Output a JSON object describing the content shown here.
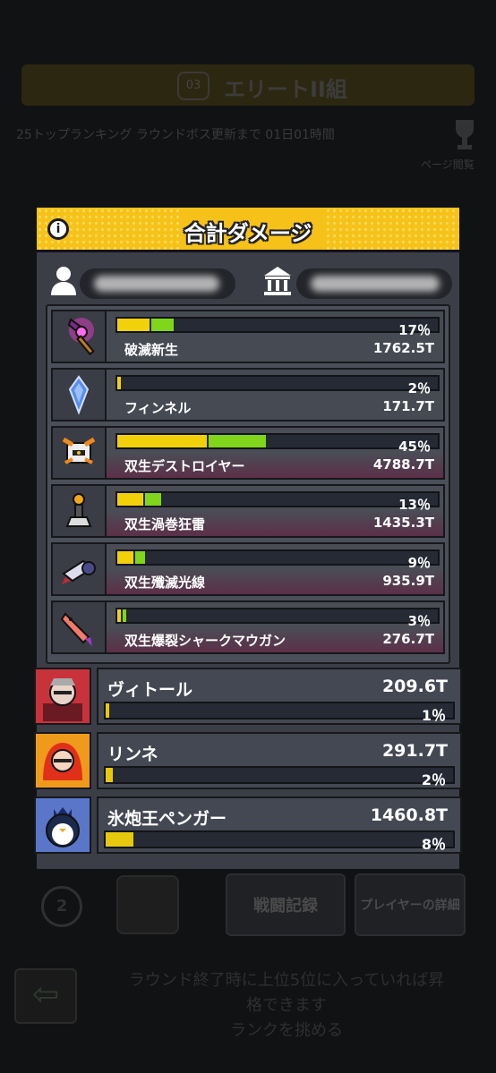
{
  "background": {
    "banner_icon": "03",
    "banner_title": "エリートII組",
    "info_text": "25トップランキング ラウンドボス更新まで 01日01時間",
    "manual_label": "ページ閲覧",
    "circle_number": "2",
    "battle_log_button": "戦闘記録",
    "player_detail_button": "プレイヤーの詳細",
    "bottom_message_1": "ラウンド終了時に上位5位に入っていれば昇",
    "bottom_message_2": "格できます",
    "bottom_message_3": "ランクを挑める"
  },
  "modal": {
    "title": "合計ダメージ",
    "info_icon": "i",
    "owner_icon": "person-icon",
    "guild_icon": "bank-icon"
  },
  "weapons": [
    {
      "name": "破滅新生",
      "percent": "17％",
      "damage": "1762.5T",
      "share": 0.17,
      "segments": [
        {
          "color": "#f2d10a",
          "w": 0.1
        },
        {
          "color": "#7fd61a",
          "w": 0.07
        }
      ],
      "highlight": false,
      "icon": "purple-staff-icon"
    },
    {
      "name": "フィンネル",
      "percent": "2％",
      "damage": "171.7T",
      "share": 0.02,
      "segments": [
        {
          "color": "#f2d10a",
          "w": 0.01
        }
      ],
      "highlight": false,
      "icon": "blue-crystal-icon"
    },
    {
      "name": "双生デストロイヤー",
      "percent": "45％",
      "damage": "4788.7T",
      "share": 0.45,
      "segments": [
        {
          "color": "#f2d10a",
          "w": 0.28
        },
        {
          "color": "#7fd61a",
          "w": 0.18
        }
      ],
      "highlight": true,
      "icon": "robot-destroyer-icon"
    },
    {
      "name": "双生渦巻狂雷",
      "percent": "13％",
      "damage": "1435.3T",
      "share": 0.13,
      "segments": [
        {
          "color": "#f2d10a",
          "w": 0.08
        },
        {
          "color": "#7fd61a",
          "w": 0.05
        }
      ],
      "highlight": true,
      "icon": "tesla-coil-icon"
    },
    {
      "name": "双生殲滅光線",
      "percent": "9％",
      "damage": "935.9T",
      "share": 0.09,
      "segments": [
        {
          "color": "#f2d10a",
          "w": 0.05
        },
        {
          "color": "#7fd61a",
          "w": 0.03
        }
      ],
      "highlight": true,
      "icon": "laser-cannon-icon"
    },
    {
      "name": "双生爆裂シャークマウガン",
      "percent": "3％",
      "damage": "276.7T",
      "share": 0.03,
      "segments": [
        {
          "color": "#f2d10a",
          "w": 0.01
        },
        {
          "color": "#7fd61a",
          "w": 0.01
        }
      ],
      "highlight": true,
      "icon": "shark-rocket-icon"
    }
  ],
  "heroes": [
    {
      "name": "ヴィトール",
      "damage": "209.6T",
      "percent": "1％",
      "share": 0.01,
      "bg": "#c8323a",
      "icon": "vampire-hero-icon"
    },
    {
      "name": "リンネ",
      "damage": "291.7T",
      "percent": "2％",
      "share": 0.02,
      "bg": "#f09a1c",
      "icon": "fire-girl-hero-icon"
    },
    {
      "name": "氷炮王ペンガー",
      "damage": "1460.8T",
      "percent": "8％",
      "share": 0.08,
      "bg": "#5a76c8",
      "icon": "penguin-king-hero-icon"
    }
  ]
}
